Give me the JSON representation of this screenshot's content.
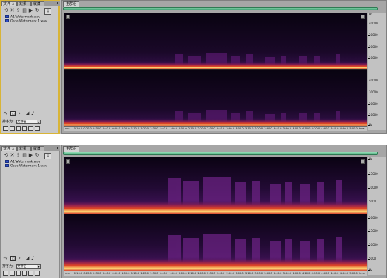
{
  "colors": {
    "panel_bg": "#c9c9c9",
    "active_panel_border": "#d8b437",
    "overview_bar": "#63c894",
    "spectrogram_hot": "#ffd060",
    "spectrogram_mid": "#d2302c",
    "spectrogram_low": "#4a1a6a",
    "spectrogram_bg": "#07020c"
  },
  "shots": [
    {
      "panel_tabs": [
        "文件 ×",
        "效果",
        "收藏"
      ],
      "files": [
        "A1 Watermark.wav",
        "Ospe-Watermark 1.wav"
      ],
      "sort_label": "排序为:",
      "sort_value": "文件名",
      "editor_tab": "主群组",
      "hz_labels_top": [
        "Hz",
        "40000",
        "30000",
        "20000",
        "10000"
      ],
      "hz_labels_bottom": [
        "40000",
        "30000",
        "20000",
        "10000",
        "Hz"
      ],
      "time_ticks": [
        "hms",
        "0:10.0",
        "0:20.0",
        "0:30.0",
        "0:40.0",
        "0:50.0",
        "1:00.0",
        "1:10.0",
        "1:20.0",
        "1:30.0",
        "1:40.0",
        "1:50.0",
        "2:00.0",
        "2:10.0",
        "2:20.0",
        "2:30.0",
        "2:40.0",
        "2:50.0",
        "3:00.0",
        "3:10.0",
        "3:20.0",
        "3:30.0",
        "3:40.0",
        "3:50.0",
        "4:00.0",
        "4:10.0",
        "4:20.0",
        "4:30.0",
        "4:40.0",
        "4:50.0",
        "5:00.0",
        "hms"
      ]
    },
    {
      "panel_tabs": [
        "文件 ×",
        "效果",
        "收藏"
      ],
      "files": [
        "A1 Watermark.wav",
        "Ospe-Watermark 1.wav"
      ],
      "sort_label": "排序为:",
      "sort_value": "文件名",
      "editor_tab": "主群组",
      "hz_labels_top": [
        "Hz",
        "15000",
        "10000",
        "5000"
      ],
      "hz_labels_bottom": [
        "20000",
        "15000",
        "10000",
        "5000",
        "Hz"
      ],
      "time_ticks": [
        "hms",
        "0:10.0",
        "0:20.0",
        "0:30.0",
        "0:40.0",
        "0:50.0",
        "1:00.0",
        "1:10.0",
        "1:20.0",
        "1:30.0",
        "1:40.0",
        "1:50.0",
        "2:00.0",
        "2:10.0",
        "2:20.0",
        "2:30.0",
        "2:40.0",
        "2:50.0",
        "3:00.0",
        "3:10.0",
        "3:20.0",
        "3:30.0",
        "3:40.0",
        "3:50.0",
        "4:00.0",
        "4:10.0",
        "4:20.0",
        "4:30.0",
        "4:40.0",
        "4:50.0",
        "5:00.0",
        "hms"
      ]
    }
  ]
}
